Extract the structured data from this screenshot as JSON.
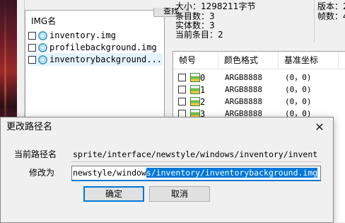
{
  "left_panel": {
    "search_button_label": "查找"
  },
  "img_list": {
    "header": "IMG名",
    "items": [
      {
        "label": "inventory.img"
      },
      {
        "label": "profilebackground.img"
      },
      {
        "label": "inventorybackground..."
      }
    ]
  },
  "info": {
    "size": "大小：1298211字节",
    "entry_count": "条目数：3",
    "entity_count": "实体数：3",
    "current_entry": "当前条目：2",
    "version": "版本：2",
    "frames": "帧数：4"
  },
  "frame_table": {
    "columns": [
      "帧号",
      "颜色格式",
      "基准坐标"
    ],
    "rows": [
      {
        "no": "0",
        "format": "ARGB8888",
        "point": "(0，0)"
      },
      {
        "no": "1",
        "format": "ARGB8888",
        "point": "(0，0)"
      },
      {
        "no": "2",
        "format": "ARGB8888",
        "point": "(0，0)"
      },
      {
        "no": "3",
        "format": "ARGB8888",
        "point": "(0，0)"
      }
    ]
  },
  "dialog": {
    "title": "更改路径名",
    "close_icon": "close-icon",
    "current_path_label": "当前路径名",
    "current_path_value": "sprite/interface/newstyle/windows/inventory/invent",
    "rename_label": "修改为",
    "new_path_unselected": "newstyle/window",
    "new_path_selected": "s/inventory/inventorybackground.img",
    "ok_label": "确定",
    "cancel_label": "取消"
  }
}
